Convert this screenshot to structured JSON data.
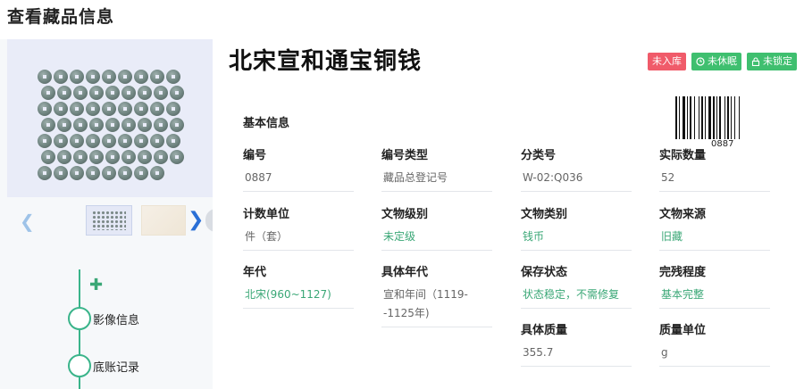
{
  "page": {
    "title": "查看藏品信息"
  },
  "item": {
    "name": "北宋宣和通宝铜钱",
    "badges": [
      {
        "label": "未入库",
        "color": "#f05b6a",
        "icon": ""
      },
      {
        "label": "未休眠",
        "color": "#3fbf6f",
        "icon": "clock-icon"
      },
      {
        "label": "未锁定",
        "color": "#3fbf6f",
        "icon": "lock-icon"
      }
    ]
  },
  "gallery": {
    "prev_icon": "chevron-left-icon",
    "next_icon": "chevron-right-icon"
  },
  "timeline": {
    "add_icon": "plus-icon",
    "items": [
      {
        "label": "影像信息"
      },
      {
        "label": "底账记录"
      }
    ]
  },
  "info": {
    "section_title": "基本信息",
    "barcode_number": "0887",
    "fields": [
      {
        "label": "编号",
        "value": "0887"
      },
      {
        "label": "编号类型",
        "value": "藏品总登记号"
      },
      {
        "label": "分类号",
        "value": "W-02:Q036"
      },
      {
        "label": "实际数量",
        "value": "52"
      },
      {
        "label": "计数单位",
        "value": "件（套）"
      },
      {
        "label": "文物级别",
        "value": "未定级"
      },
      {
        "label": "文物类别",
        "value": "钱币"
      },
      {
        "label": "文物来源",
        "value": "旧藏"
      },
      {
        "label": "年代",
        "value": "北宋(960~1127)"
      },
      {
        "label": "具体年代",
        "value": "宣和年间（1119--1125年)"
      },
      {
        "label": "保存状态",
        "value": "状态稳定，不需修复"
      },
      {
        "label": "完残程度",
        "value": "基本完整"
      },
      {
        "label": "具体质量",
        "value": "355.7"
      },
      {
        "label": "质量单位",
        "value": "g"
      }
    ]
  }
}
